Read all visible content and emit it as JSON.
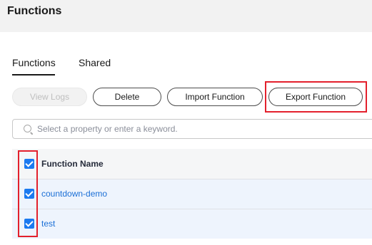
{
  "page": {
    "title": "Functions"
  },
  "tabs": [
    {
      "label": "Functions",
      "active": true
    },
    {
      "label": "Shared",
      "active": false
    }
  ],
  "toolbar": {
    "view_logs_label": "View Logs",
    "delete_label": "Delete",
    "import_label": "Import Function",
    "export_label": "Export Function"
  },
  "search": {
    "placeholder": "Select a property or enter a keyword."
  },
  "table": {
    "columns": [
      "Function Name"
    ],
    "rows": [
      {
        "name": "countdown-demo",
        "checked": true
      },
      {
        "name": "test",
        "checked": true
      }
    ],
    "header_checked": true
  },
  "colors": {
    "accent": "#1b7af0",
    "link": "#1b6fd6",
    "highlight": "#e3202c",
    "row_selected": "#eef4fd"
  }
}
